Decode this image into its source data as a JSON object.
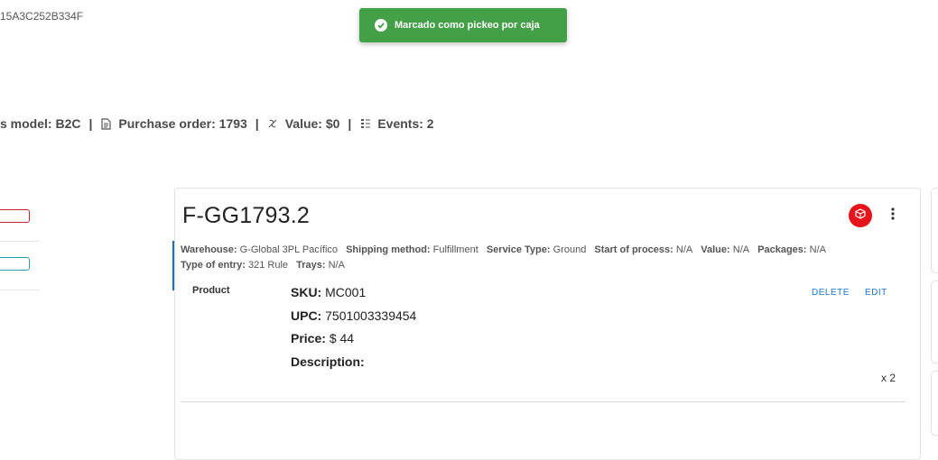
{
  "header": {
    "order_id": "15A3C252B334F"
  },
  "toast": {
    "message": "Marcado como pickeo por caja",
    "color": "#43a047"
  },
  "summary": {
    "business_model": "s model: B2C",
    "purchase_order": "Purchase order: 1793",
    "value": "Value: $0",
    "events": "Events: 2",
    "separator": "|"
  },
  "shipment": {
    "title": "F-GG1793.2",
    "fields": [
      {
        "label": "Warehouse:",
        "value": "G-Global 3PL Pacífico"
      },
      {
        "label": "Shipping method:",
        "value": "Fulfillment"
      },
      {
        "label": "Service Type:",
        "value": "Ground"
      },
      {
        "label": "Start of process:",
        "value": "N/A"
      },
      {
        "label": "Value:",
        "value": "N/A"
      },
      {
        "label": "Packages:",
        "value": "N/A"
      },
      {
        "label": "Type of entry:",
        "value": "321 Rule"
      },
      {
        "label": "Trays:",
        "value": "N/A"
      }
    ]
  },
  "product": {
    "image_alt": "Product",
    "sku_label": "SKU:",
    "sku": "MC001",
    "upc_label": "UPC:",
    "upc": "7501003339454",
    "price_label": "Price:",
    "price": "$ 44",
    "description_label": "Description:",
    "description": "",
    "quantity": "x 2",
    "delete_label": "DELETE",
    "edit_label": "EDIT"
  },
  "icons": {
    "toast": "check-circle-icon",
    "purchase_order": "document-icon",
    "value": "money-icon",
    "events": "list-icon",
    "box": "box-icon",
    "more": "more-vertical-icon"
  }
}
